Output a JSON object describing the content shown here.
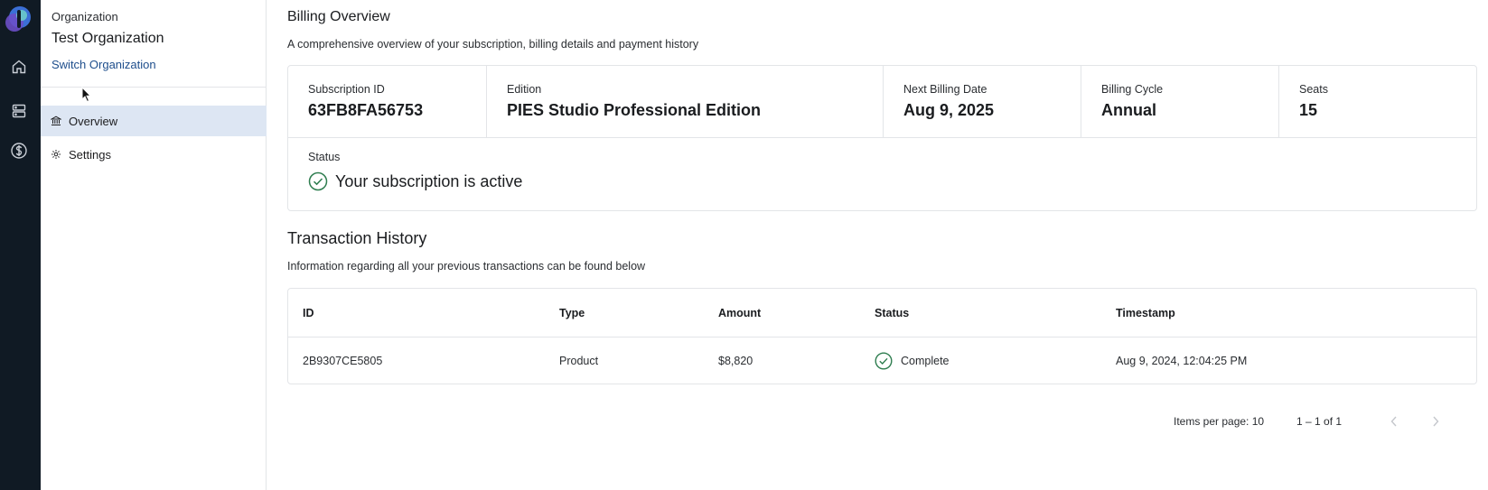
{
  "rail": {
    "icons": [
      "app-logo",
      "home-icon",
      "server-icon",
      "billing-icon"
    ]
  },
  "sidebar": {
    "org_label": "Organization",
    "org_name": "Test Organization",
    "switch_label": "Switch Organization",
    "items": [
      {
        "label": "Overview",
        "icon": "bank-icon",
        "active": true
      },
      {
        "label": "Settings",
        "icon": "gear-icon",
        "active": false
      }
    ]
  },
  "billing_overview": {
    "title": "Billing Overview",
    "description": "A comprehensive overview of your subscription, billing details and payment history",
    "fields": [
      {
        "label": "Subscription ID",
        "value": "63FB8FA56753"
      },
      {
        "label": "Edition",
        "value": "PIES Studio Professional Edition"
      },
      {
        "label": "Next Billing Date",
        "value": "Aug 9, 2025"
      },
      {
        "label": "Billing Cycle",
        "value": "Annual"
      },
      {
        "label": "Seats",
        "value": "15"
      }
    ],
    "status_label": "Status",
    "status_text": "Your subscription is active"
  },
  "transactions": {
    "title": "Transaction History",
    "description": "Information regarding all your previous transactions can be found below",
    "columns": [
      "ID",
      "Type",
      "Amount",
      "Status",
      "Timestamp"
    ],
    "rows": [
      {
        "id": "2B9307CE5805",
        "type": "Product",
        "amount": "$8,820",
        "status": "Complete",
        "timestamp": "Aug 9, 2024, 12:04:25 PM"
      }
    ],
    "pager": {
      "items_per_page": "Items per page: 10",
      "range": "1 – 1 of 1"
    }
  },
  "colors": {
    "rail_bg": "#101a24",
    "active_nav_bg": "#dde6f3",
    "link": "#1e4e8c",
    "success": "#2e7d4f"
  }
}
